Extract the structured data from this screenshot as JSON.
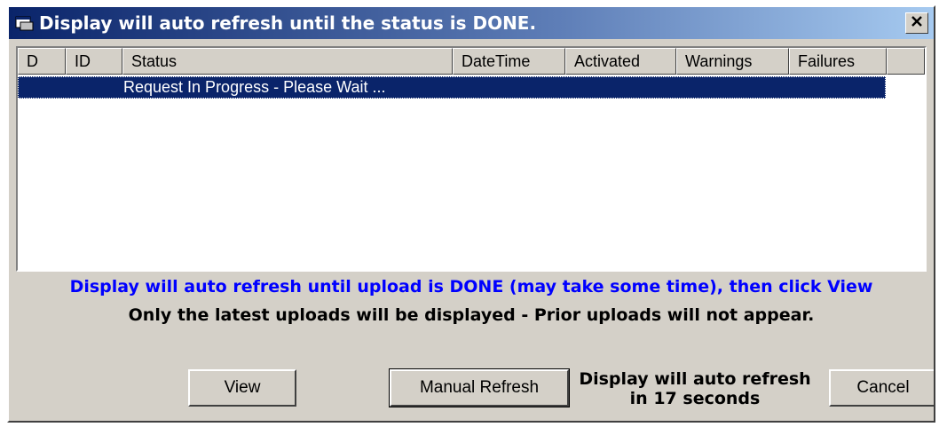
{
  "window": {
    "title": "Display will auto refresh until the status is DONE.",
    "close_label": "×"
  },
  "table": {
    "columns": [
      "D",
      "ID",
      "Status",
      "DateTime",
      "Activated",
      "Warnings",
      "Failures"
    ],
    "rows": [
      {
        "D": "",
        "ID": "",
        "Status": "Request In Progress - Please Wait ...",
        "DateTime": "",
        "Activated": "",
        "Warnings": "",
        "Failures": "",
        "selected": true
      }
    ]
  },
  "messages": {
    "info_blue": "Display will auto refresh until upload is DONE (may take some time), then click View",
    "info_black": "Only the latest uploads will be displayed - Prior uploads will not appear."
  },
  "buttons": {
    "view": "View",
    "manual_refresh": "Manual Refresh",
    "cancel": "Cancel"
  },
  "countdown": {
    "line1": "Display will auto refresh",
    "line2": "in 17 seconds"
  },
  "colors": {
    "selection": "#0a246a",
    "info_blue": "#0000ff",
    "face": "#d4d0c8"
  },
  "icons": {
    "app": "window-app-icon",
    "close": "close-icon"
  }
}
